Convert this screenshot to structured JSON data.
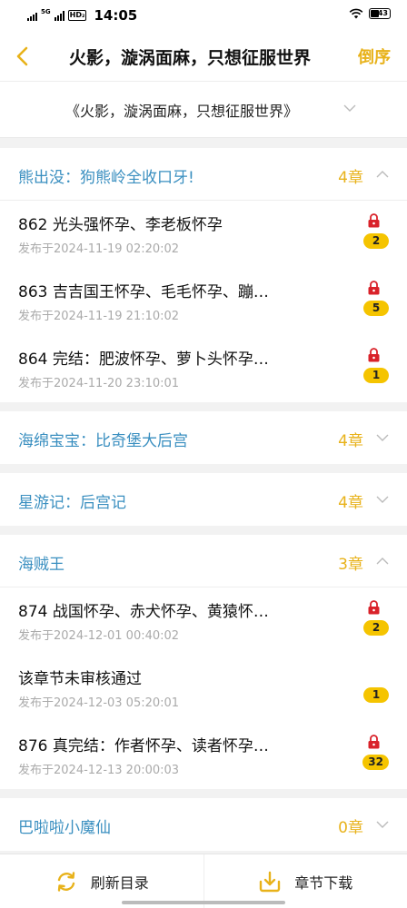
{
  "status": {
    "network": "5G",
    "hd": "HD₂",
    "time": "14:05",
    "battery": "43"
  },
  "header": {
    "title": "火影，漩涡面麻，只想征服世界",
    "order_label": "倒序"
  },
  "book": {
    "name": "《火影，漩涡面麻，只想征服世界》"
  },
  "volumes": [
    {
      "title": "熊出没：狗熊岭全收口牙!",
      "count": "4章",
      "chapters": [
        {
          "title": "862 光头强怀孕、李老板怀孕",
          "date": "发布于2024-11-19 02:20:02",
          "badge": "2"
        },
        {
          "title": "863 吉吉国王怀孕、毛毛怀孕、蹦…",
          "date": "发布于2024-11-19 21:10:02",
          "badge": "5"
        },
        {
          "title": "864 完结：肥波怀孕、萝卜头怀孕…",
          "date": "发布于2024-11-20 23:10:01",
          "badge": "1"
        }
      ]
    },
    {
      "title": "海绵宝宝：比奇堡大后宫",
      "count": "4章"
    },
    {
      "title": "星游记：后宫记",
      "count": "4章"
    },
    {
      "title": "海贼王",
      "count": "3章",
      "chapters": [
        {
          "title": "874 战国怀孕、赤犬怀孕、黄猿怀…",
          "date": "发布于2024-12-01 00:40:02",
          "badge": "2"
        },
        {
          "title": "该章节未审核通过",
          "date": "发布于2024-12-03 05:20:01",
          "badge": "1"
        },
        {
          "title": "876 真完结：作者怀孕、读者怀孕…",
          "date": "发布于2024-12-13 20:00:03",
          "badge": "32"
        }
      ]
    },
    {
      "title": "巴啦啦小魔仙",
      "count": "0章"
    }
  ],
  "bottom": {
    "refresh_label": "刷新目录",
    "download_label": "章节下载"
  },
  "colors": {
    "accent": "#e8b21a",
    "volume_title": "#3a8fc0",
    "lock": "#d9222a",
    "badge": "#f5c400"
  }
}
